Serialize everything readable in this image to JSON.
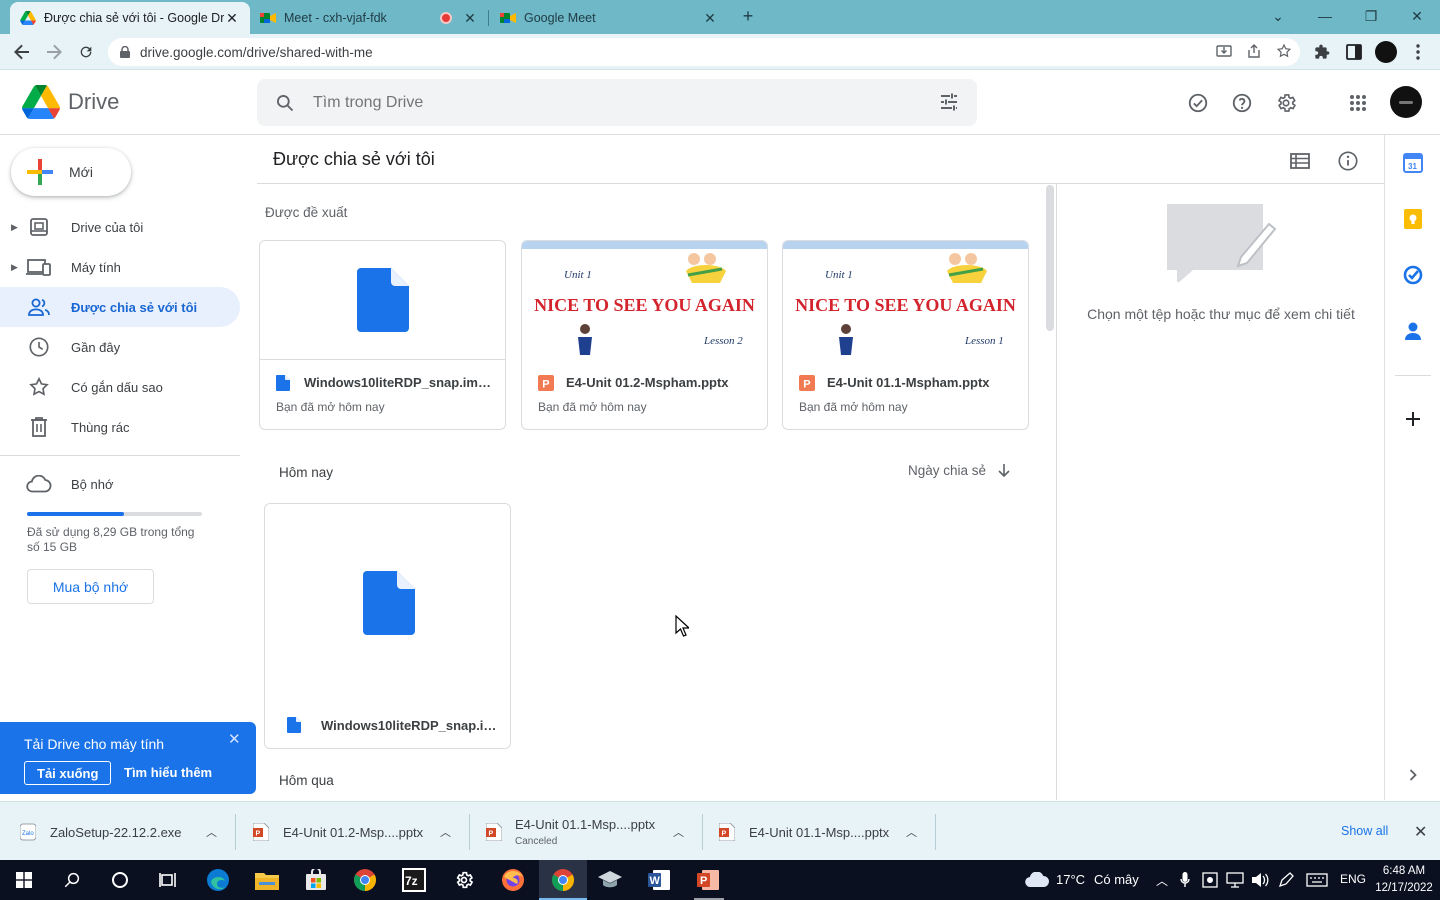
{
  "browser": {
    "tabs": [
      {
        "title": "Được chia sẻ với tôi - Google Drive",
        "active": true
      },
      {
        "title": "Meet - cxh-vjaf-fdk",
        "active": false
      },
      {
        "title": "Google Meet",
        "active": false
      }
    ],
    "url": "drive.google.com/drive/shared-with-me"
  },
  "drive": {
    "app_name": "Drive",
    "search_placeholder": "Tìm trong Drive",
    "new_label": "Mới",
    "nav": [
      {
        "label": "Drive của tôi",
        "icon": "my-drive-icon"
      },
      {
        "label": "Máy tính",
        "icon": "computers-icon"
      },
      {
        "label": "Được chia sẻ với tôi",
        "icon": "shared-icon",
        "active": true
      },
      {
        "label": "Gần đây",
        "icon": "recent-icon"
      },
      {
        "label": "Có gắn dấu sao",
        "icon": "star-icon"
      },
      {
        "label": "Thùng rác",
        "icon": "trash-icon"
      }
    ],
    "storage": {
      "label": "Bộ nhớ",
      "used_fraction": 0.553,
      "text": "Đã sử dụng 8,29 GB trong tổng số 15 GB",
      "buy_label": "Mua bộ nhớ"
    },
    "promo": {
      "title": "Tải Drive cho máy tính",
      "download_label": "Tải xuống",
      "learn_more_label": "Tìm hiểu thêm"
    },
    "page_title": "Được chia sẻ với tôi",
    "suggested_label": "Được đề xuất",
    "suggested": [
      {
        "name": "Windows10liteRDP_snap.img....",
        "sub": "Bạn đã mở hôm nay",
        "type": "file"
      },
      {
        "name": "E4-Unit 01.2-Mspham.pptx",
        "sub": "Bạn đã mở hôm nay",
        "type": "pptx",
        "slide": {
          "unit": "Unit 1",
          "heading": "NICE TO SEE YOU AGAIN",
          "lesson": "Lesson 2"
        }
      },
      {
        "name": "E4-Unit 01.1-Mspham.pptx",
        "sub": "Bạn đã mở hôm nay",
        "type": "pptx",
        "slide": {
          "unit": "Unit 1",
          "heading": "NICE TO SEE YOU AGAIN",
          "lesson": "Lesson 1"
        }
      }
    ],
    "today_label": "Hôm nay",
    "sort_label": "Ngày chia sẻ",
    "today_files": [
      {
        "name": "Windows10liteRDP_snap.im..."
      }
    ],
    "yesterday_label": "Hôm qua",
    "details_text": "Chọn một tệp hoặc thư mục để xem chi tiết"
  },
  "downloads": {
    "items": [
      {
        "name": "ZaloSetup-22.12.2.exe",
        "status": ""
      },
      {
        "name": "E4-Unit 01.2-Msp....pptx",
        "status": ""
      },
      {
        "name": "E4-Unit 01.1-Msp....pptx",
        "status": "Canceled"
      },
      {
        "name": "E4-Unit 01.1-Msp....pptx",
        "status": ""
      }
    ],
    "show_all": "Show all"
  },
  "taskbar": {
    "weather": "17°C",
    "weather_desc": "Có mây",
    "lang": "ENG",
    "time": "6:48 AM",
    "date": "12/17/2022"
  },
  "colors": {
    "tabbar": "#6fb8c7",
    "accent": "#1a73e8",
    "active_nav_bg": "#e8f0fe",
    "pptx": "#d24726"
  }
}
